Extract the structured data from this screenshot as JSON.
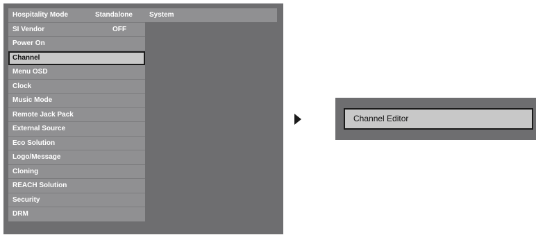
{
  "menu": {
    "items": [
      {
        "label": "Hospitality Mode",
        "value": "Standalone"
      },
      {
        "label": "SI Vendor",
        "value": "OFF"
      },
      {
        "label": "Power On"
      },
      {
        "label": "Channel"
      },
      {
        "label": "Menu OSD"
      },
      {
        "label": "Clock"
      },
      {
        "label": "Music Mode"
      },
      {
        "label": "Remote Jack Pack"
      },
      {
        "label": "External Source"
      },
      {
        "label": "Eco Solution"
      },
      {
        "label": "Logo/Message"
      },
      {
        "label": "Cloning"
      },
      {
        "label": "REACH Solution"
      },
      {
        "label": "Security"
      },
      {
        "label": "DRM"
      }
    ],
    "selected_label": "Channel"
  },
  "submenu": {
    "header": "System"
  },
  "editor": {
    "item_label": "Channel Editor"
  },
  "colors": {
    "panel_bg": "#6e6e70",
    "item_bg": "#909092",
    "selected_bg": "#c8c8c8",
    "selected_border": "#1a1a1a"
  }
}
